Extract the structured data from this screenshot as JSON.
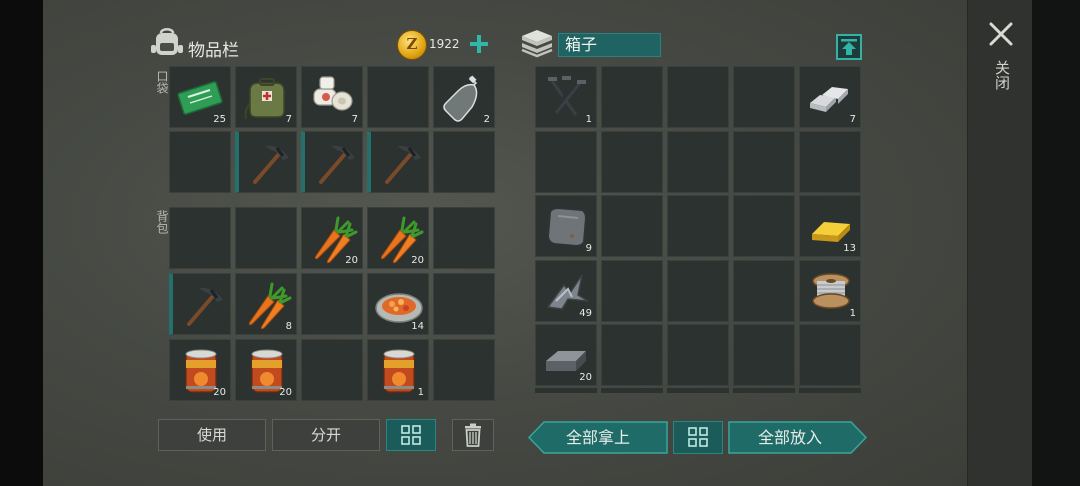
{
  "inventory": {
    "title": "物品栏",
    "coins": "1922",
    "pocket_label": "口袋",
    "backpack_label": "背包",
    "pocket": [
      {
        "icon": "ration-coupon-icon",
        "qty": "25"
      },
      {
        "icon": "medical-kit-icon",
        "qty": "7"
      },
      {
        "icon": "bandage-icon",
        "qty": "7"
      },
      {
        "icon": "",
        "qty": ""
      },
      {
        "icon": "water-bottle-icon",
        "qty": "2"
      },
      {
        "icon": "",
        "qty": ""
      },
      {
        "icon": "pickaxe-icon",
        "qty": ""
      },
      {
        "icon": "pickaxe-icon",
        "qty": ""
      },
      {
        "icon": "pickaxe-icon",
        "qty": ""
      },
      {
        "icon": "",
        "qty": ""
      }
    ],
    "backpack": [
      {
        "icon": "",
        "qty": ""
      },
      {
        "icon": "",
        "qty": ""
      },
      {
        "icon": "carrot-icon",
        "qty": "20"
      },
      {
        "icon": "carrot-icon",
        "qty": "20"
      },
      {
        "icon": "",
        "qty": ""
      },
      {
        "icon": "pickaxe-icon",
        "qty": ""
      },
      {
        "icon": "carrot-icon",
        "qty": "8"
      },
      {
        "icon": "",
        "qty": ""
      },
      {
        "icon": "stew-bowl-icon",
        "qty": "14"
      },
      {
        "icon": "",
        "qty": ""
      },
      {
        "icon": "canned-food-icon",
        "qty": "20"
      },
      {
        "icon": "canned-food-icon",
        "qty": "20"
      },
      {
        "icon": "",
        "qty": ""
      },
      {
        "icon": "canned-food-icon",
        "qty": "1"
      },
      {
        "icon": "",
        "qty": ""
      }
    ],
    "buttons": {
      "use": "使用",
      "split": "分开"
    }
  },
  "box": {
    "title": "箱子",
    "slots": [
      {
        "icon": "nails-icon",
        "qty": "1"
      },
      {
        "icon": "",
        "qty": ""
      },
      {
        "icon": "",
        "qty": ""
      },
      {
        "icon": "",
        "qty": ""
      },
      {
        "icon": "silver-ingots-icon",
        "qty": "7"
      },
      {
        "icon": "",
        "qty": ""
      },
      {
        "icon": "",
        "qty": ""
      },
      {
        "icon": "",
        "qty": ""
      },
      {
        "icon": "",
        "qty": ""
      },
      {
        "icon": "",
        "qty": ""
      },
      {
        "icon": "iron-plate-icon",
        "qty": "9"
      },
      {
        "icon": "",
        "qty": ""
      },
      {
        "icon": "",
        "qty": ""
      },
      {
        "icon": "",
        "qty": ""
      },
      {
        "icon": "gold-ingot-icon",
        "qty": "13"
      },
      {
        "icon": "scrap-metal-icon",
        "qty": "49"
      },
      {
        "icon": "",
        "qty": ""
      },
      {
        "icon": "",
        "qty": ""
      },
      {
        "icon": "",
        "qty": ""
      },
      {
        "icon": "wire-spool-icon",
        "qty": "1"
      },
      {
        "icon": "iron-ingot-icon",
        "qty": "20"
      },
      {
        "icon": "",
        "qty": ""
      },
      {
        "icon": "",
        "qty": ""
      },
      {
        "icon": "",
        "qty": ""
      },
      {
        "icon": "",
        "qty": ""
      }
    ],
    "buttons": {
      "take_all": "全部拿上",
      "put_all": "全部放入"
    }
  },
  "sidebar": {
    "close_label": "关闭"
  },
  "colors": {
    "accent": "#2fb8a8",
    "slot": "#2c3230",
    "teal_button": "#1b5c5a"
  }
}
